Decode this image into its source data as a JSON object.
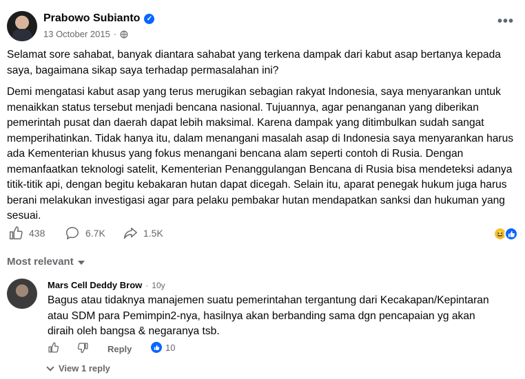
{
  "post": {
    "author": "Prabowo Subianto",
    "date": "13 October 2015",
    "separator": "·",
    "paragraphs": [
      "Selamat sore sahabat, banyak diantara sahabat yang terkena dampak dari kabut asap bertanya kepada saya, bagaimana sikap saya terhadap permasalahan ini?",
      "Demi mengatasi kabut asap yang terus merugikan sebagian rakyat Indonesia, saya menyarankan untuk menaikkan status tersebut menjadi bencana nasional. Tujuannya, agar penanganan yang diberikan pemerintah pusat dan daerah dapat lebih maksimal. Karena dampak yang ditimbulkan sudah sangat memperihatinkan. Tidak hanya itu, dalam menangani masalah asap di Indonesia saya menyarankan harus ada Kementerian khusus yang fokus menangani bencana alam seperti contoh di Rusia. Dengan memanfaatkan teknologi satelit, Kementerian Penanggulangan Bencana di Rusia bisa mendeteksi adanya titik-titik api, dengan begitu kebakaran hutan dapat dicegah. Selain itu, aparat penegak hukum juga harus berani melakukan investigasi agar para pelaku pembakar hutan mendapatkan sanksi dan hukuman yang sesuai."
    ],
    "stats": {
      "likes": "438",
      "comments": "6.7K",
      "shares": "1.5K"
    }
  },
  "comments_sort": "Most relevant",
  "comment": {
    "author": "Mars Cell Deddy Brow",
    "separator": "·",
    "time": "10y",
    "text": "Bagus atau tidaknya manajemen suatu pemerintahan tergantung dari Kecakapan/Kepintaran atau SDM para Pemimpin2-nya, hasilnya akan berbanding sama dgn pencapaian yg akan diraih oleh bangsa & negaranya tsb.",
    "reply_label": "Reply",
    "reaction_count": "10",
    "view_replies": "View 1 reply"
  },
  "colors": {
    "accent": "#0866ff",
    "secondary_text": "#65676b"
  }
}
